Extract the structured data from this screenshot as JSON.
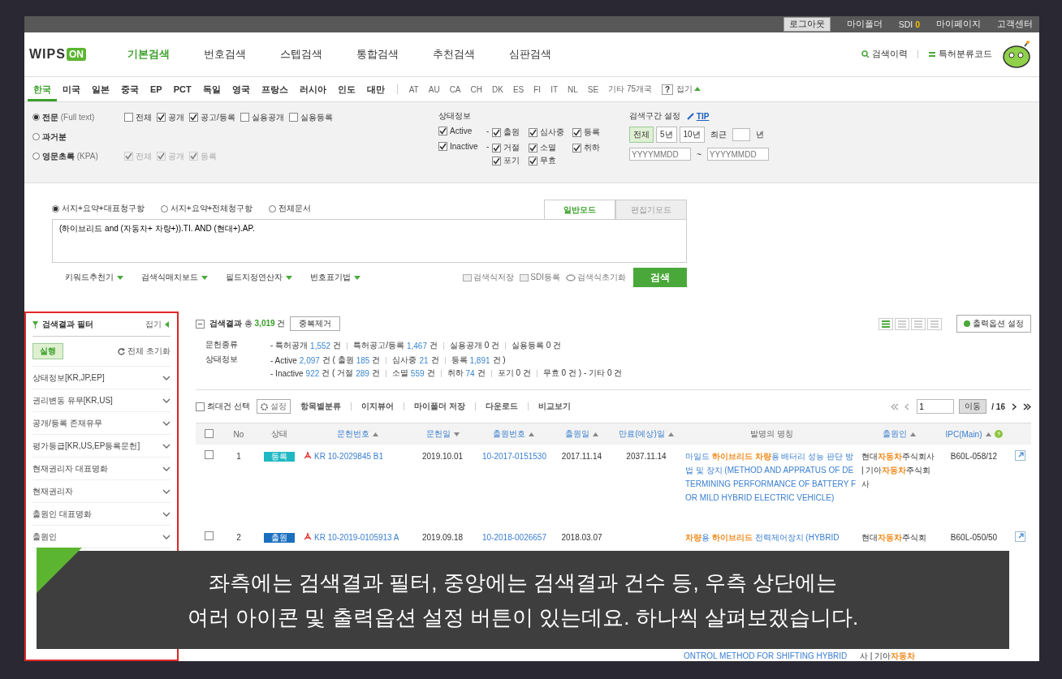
{
  "top_bar": {
    "items": [
      {
        "kind": "button",
        "label": "로그아웃"
      },
      {
        "kind": "link",
        "label": "마이폴더"
      },
      {
        "kind": "count",
        "label": "SDI",
        "count": "0"
      },
      {
        "kind": "link",
        "label": "마이페이지"
      },
      {
        "kind": "link",
        "label": "고객센터"
      }
    ]
  },
  "header": {
    "logo": {
      "text": "WIPS",
      "badge": "ON"
    },
    "nav": [
      {
        "label": "기본검색",
        "selected": true
      },
      {
        "label": "번호검색",
        "selected": false
      },
      {
        "label": "스텝검색",
        "selected": false
      },
      {
        "label": "통합검색",
        "selected": false
      },
      {
        "label": "추천검색",
        "selected": false
      },
      {
        "label": "심판검색",
        "selected": false
      }
    ],
    "tools": [
      "검색이력",
      "특허분류코드"
    ]
  },
  "countries": {
    "main": [
      {
        "label": "한국",
        "selected": true
      },
      {
        "label": "미국",
        "selected": false
      },
      {
        "label": "일본",
        "selected": false
      },
      {
        "label": "중국",
        "selected": false
      },
      {
        "label": "EP",
        "selected": false
      },
      {
        "label": "PCT",
        "selected": false
      },
      {
        "label": "독일",
        "selected": false
      },
      {
        "label": "영국",
        "selected": false
      },
      {
        "label": "프랑스",
        "selected": false
      },
      {
        "label": "러시아",
        "selected": false
      },
      {
        "label": "인도",
        "selected": false
      },
      {
        "label": "대만",
        "selected": false
      }
    ],
    "others": [
      "AT",
      "AU",
      "CA",
      "CH",
      "DK",
      "ES",
      "FI",
      "IT",
      "NL",
      "SE",
      "기타 75개국"
    ],
    "help": "?",
    "collapse": "접기"
  },
  "options": {
    "doc_types": [
      {
        "label": "전문",
        "note": "(Full text)",
        "selected": true,
        "checks": [
          {
            "label": "전체",
            "checked": false,
            "disabled": false
          },
          {
            "label": "공개",
            "checked": true,
            "disabled": false
          },
          {
            "label": "공고/등록",
            "checked": true,
            "disabled": false
          },
          {
            "label": "실용공개",
            "checked": false,
            "disabled": false
          },
          {
            "label": "실용등록",
            "checked": false,
            "disabled": false
          }
        ]
      },
      {
        "label": "과거분",
        "selected": false
      },
      {
        "label": "영문초록",
        "note": "(KPA)",
        "selected": false,
        "checks": [
          {
            "label": "전체",
            "checked": true,
            "disabled": true
          },
          {
            "label": "공개",
            "checked": true,
            "disabled": true
          },
          {
            "label": "등록",
            "checked": true,
            "disabled": true
          }
        ]
      }
    ],
    "status": {
      "title": "상태정보",
      "groups": [
        {
          "label": "Active",
          "dash": "-",
          "checked": true,
          "items": [
            {
              "label": "출원",
              "checked": true
            },
            {
              "label": "심사중",
              "checked": true
            },
            {
              "label": "등록",
              "checked": true
            }
          ]
        },
        {
          "label": "Inactive",
          "dash": "-",
          "checked": true,
          "items": [
            {
              "label": "거절",
              "checked": true
            },
            {
              "label": "소멸",
              "checked": true
            },
            {
              "label": "취하",
              "checked": true
            },
            {
              "label": "포기",
              "checked": true
            },
            {
              "label": "무효",
              "checked": true
            }
          ]
        }
      ]
    },
    "period": {
      "title": "검색구간 설정",
      "tip": "TIP",
      "presets": [
        {
          "label": "전체",
          "selected": true
        },
        {
          "label": "5년",
          "selected": false
        },
        {
          "label": "10년",
          "selected": false
        }
      ],
      "recent_label": "최근",
      "recent_unit": "년",
      "from_placeholder": "YYYYMMDD",
      "separator": "~",
      "to_placeholder": "YYYYMMDD"
    }
  },
  "search": {
    "scopes": [
      {
        "label": "서지+요약+대표청구항",
        "selected": true
      },
      {
        "label": "서지+요약+전체청구항",
        "selected": false
      },
      {
        "label": "전체문서",
        "selected": false
      }
    ],
    "modes": [
      {
        "label": "일반모드",
        "selected": true
      },
      {
        "label": "편집기모드",
        "selected": false
      }
    ],
    "query": "(하이브리드 and (자동차+ 차량+)).TI. AND (현대+).AP.",
    "tools": [
      "키워드추천기",
      "검색식매치보드",
      "필드지정연산자",
      "번호표기법"
    ],
    "actions": [
      "검색식저장",
      "SDI등록",
      "검색식초기화"
    ],
    "submit": "검색"
  },
  "filter": {
    "title": "검색결과 필터",
    "collapse": "접기",
    "run": "실행",
    "reset": "전체 초기화",
    "items": [
      "상태정보[KR,JP,EP]",
      "권리변동 유무[KR,US]",
      "공개/등록 존재유무",
      "평가등급[KR,US,EP등록문헌]",
      "현재권리자 대표명화",
      "현재권리자",
      "출원인 대표명화",
      "출원인"
    ]
  },
  "results": {
    "title": "검색결과",
    "total_prefix": "총",
    "total": "3,019",
    "total_unit": "건",
    "dedupe": "중복제거",
    "views": [
      {
        "selected": true
      },
      {
        "selected": false
      },
      {
        "selected": false
      },
      {
        "selected": false
      }
    ],
    "output_button": "출력옵션 설정",
    "summary": [
      {
        "label": "문헌종류",
        "lines": [
          [
            {
              "kind": "text",
              "text": "- 특허공개"
            },
            {
              "kind": "count",
              "text": "1,552"
            },
            {
              "kind": "text",
              "text": "건"
            },
            {
              "kind": "sep"
            },
            {
              "kind": "text",
              "text": "특허공고/등록"
            },
            {
              "kind": "count",
              "text": "1,467"
            },
            {
              "kind": "text",
              "text": "건"
            },
            {
              "kind": "sep"
            },
            {
              "kind": "text",
              "text": "실용공개 0 건"
            },
            {
              "kind": "sep"
            },
            {
              "kind": "text",
              "text": "실용등록 0 건"
            }
          ]
        ]
      },
      {
        "label": "상태정보",
        "lines": [
          [
            {
              "kind": "text",
              "text": "- Active"
            },
            {
              "kind": "count",
              "text": "2,097"
            },
            {
              "kind": "text",
              "text": "건 ( 출원"
            },
            {
              "kind": "count",
              "text": "185"
            },
            {
              "kind": "text",
              "text": "건"
            },
            {
              "kind": "sep"
            },
            {
              "kind": "text",
              "text": "심사중"
            },
            {
              "kind": "count",
              "text": "21"
            },
            {
              "kind": "text",
              "text": "건"
            },
            {
              "kind": "sep"
            },
            {
              "kind": "text",
              "text": "등록"
            },
            {
              "kind": "count",
              "text": "1,891"
            },
            {
              "kind": "text",
              "text": "건 )"
            }
          ],
          [
            {
              "kind": "text",
              "text": "- Inactive"
            },
            {
              "kind": "count",
              "text": "922"
            },
            {
              "kind": "text",
              "text": "건 ( 거절"
            },
            {
              "kind": "count",
              "text": "289"
            },
            {
              "kind": "text",
              "text": "건"
            },
            {
              "kind": "sep"
            },
            {
              "kind": "text",
              "text": "소멸"
            },
            {
              "kind": "count",
              "text": "559"
            },
            {
              "kind": "text",
              "text": "건"
            },
            {
              "kind": "sep"
            },
            {
              "kind": "text",
              "text": "취하"
            },
            {
              "kind": "count",
              "text": "74"
            },
            {
              "kind": "text",
              "text": "건"
            },
            {
              "kind": "sep"
            },
            {
              "kind": "text",
              "text": "포기 0 건"
            },
            {
              "kind": "sep"
            },
            {
              "kind": "text",
              "text": "무효 0 건 )"
            },
            {
              "kind": "text",
              "text": "- 기타 0 건"
            }
          ]
        ]
      }
    ],
    "toolbar": {
      "select_max": {
        "label": "최대건 선택",
        "checked": false
      },
      "settings": "설정",
      "actions": [
        "항목별분류",
        "이지뷰어",
        "마이폴더 저장",
        "다운로드",
        "비교보기"
      ]
    },
    "pager": {
      "page": "1",
      "go": "이동",
      "total": "/ 16"
    },
    "table": {
      "columns": [
        {
          "kind": "checkbox",
          "checked": false
        },
        {
          "kind": "text",
          "label": "No"
        },
        {
          "kind": "text",
          "label": "상태"
        },
        {
          "kind": "text",
          "label": "문헌번호",
          "sort_descending": false
        },
        {
          "kind": "text",
          "label": "문헌일",
          "sort_descending": true
        },
        {
          "kind": "text",
          "label": "출원번호",
          "sort_descending": false
        },
        {
          "kind": "text",
          "label": "출원일",
          "sort_descending": false
        },
        {
          "kind": "text",
          "label": "만료(예상)일",
          "sort_descending": false
        },
        {
          "kind": "text",
          "label": "발명의 명칭"
        },
        {
          "kind": "text",
          "label": "출원인",
          "sort_descending": false
        },
        {
          "kind": "help",
          "label": "IPC(Main)",
          "sort_descending": false
        }
      ],
      "rows": [
        {
          "checked": false,
          "no": "1",
          "status": {
            "label": "등록",
            "color": "#1fb8c3"
          },
          "doc_no": "KR 10-2029845 B1",
          "doc_date": "2019.10.01",
          "app_no": "10-2017-0151530",
          "app_date": "2017.11.14",
          "expiry": "2037.11.14",
          "title": "마일드 **하이브리드 차량**용 배터리 성능 판단 방법 및 장치 (METHOD AND APPRATUS OF DETERMINING PERFORMANCE OF BATTERY FOR MILD HYBRID ELECTRIC VEHICLE)",
          "applicant": "현대**자동차**주식회사 | 기아**자동차**주식회사",
          "ipc": "B60L-058/12"
        },
        {
          "checked": false,
          "no": "2",
          "status": {
            "label": "출원",
            "color": "#1a6fbf"
          },
          "doc_no": "KR 10-2019-0105913 A",
          "doc_date": "2019.09.18",
          "app_no": "10-2018-0026657",
          "app_date": "2018.03.07",
          "title": "**차량**용 **하이브리드** 전력제어장치 (HYBRID",
          "applicant": "현대**자동차**주식회",
          "ipc": "B60L-050/50"
        }
      ],
      "partial_row": {
        "title": "ONTROL METHOD FOR SHIFTING HYBRID",
        "applicant": "사 | 기아**자동차**"
      }
    }
  },
  "caption": {
    "lines": [
      "좌측에는 검색결과 필터, 중앙에는 검색결과 건수 등, 우측 상단에는",
      "여러 아이콘 및 출력옵션 설정 버튼이 있는데요. 하나씩 살펴보겠습니다."
    ]
  }
}
